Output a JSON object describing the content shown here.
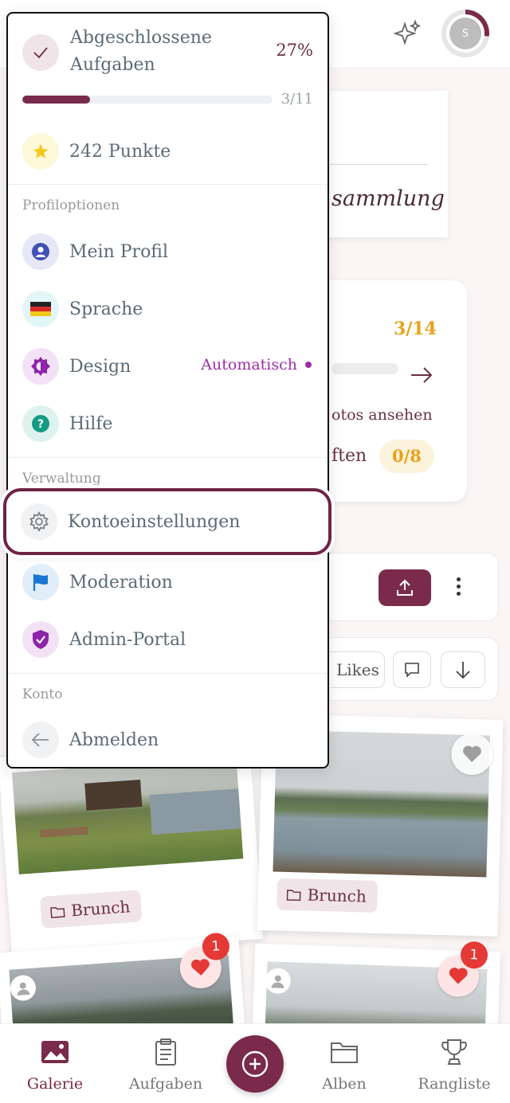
{
  "header": {
    "avatar_initial": "S",
    "avatar_progress": 0.27
  },
  "background": {
    "collection_text": "sammlung",
    "stats_fraction_1": "3/14",
    "stats_line_1": "otos ansehen",
    "stats_line_2": "ften",
    "stats_fraction_2": "0/8",
    "likes_label": "Likes"
  },
  "menu": {
    "tasks": {
      "title_line1": "Abgeschlossene",
      "title_line2": "Aufgaben",
      "percent": "27%",
      "count": "3/11",
      "progress": 0.27
    },
    "points_label": "242 Punkte",
    "section_profile": "Profiloptionen",
    "profile_items": [
      {
        "label": "Mein Profil",
        "icon": "user-icon"
      },
      {
        "label": "Sprache",
        "icon": "german-flag-icon"
      },
      {
        "label": "Design",
        "icon": "theme-icon",
        "value": "Automatisch"
      },
      {
        "label": "Hilfe",
        "icon": "help-icon"
      }
    ],
    "section_admin": "Verwaltung",
    "admin_items": [
      {
        "label": "Kontoeinstellungen",
        "icon": "gear-icon"
      },
      {
        "label": "Moderation",
        "icon": "flag-icon"
      },
      {
        "label": "Admin-Portal",
        "icon": "shield-icon"
      }
    ],
    "section_account": "Konto",
    "logout_label": "Abmelden"
  },
  "gallery": {
    "tags": [
      "Brunch",
      "Brunch"
    ],
    "badges": [
      "1",
      "1"
    ]
  },
  "bottom_nav": [
    {
      "label": "Galerie",
      "active": true
    },
    {
      "label": "Aufgaben",
      "active": false
    },
    {
      "label": "Alben",
      "active": false
    },
    {
      "label": "Rangliste",
      "active": false
    }
  ],
  "colors": {
    "brand": "#7a2a4a",
    "accent_gold": "#e8a21a",
    "design_purple": "#9b30a8",
    "badge_red": "#e53935"
  }
}
